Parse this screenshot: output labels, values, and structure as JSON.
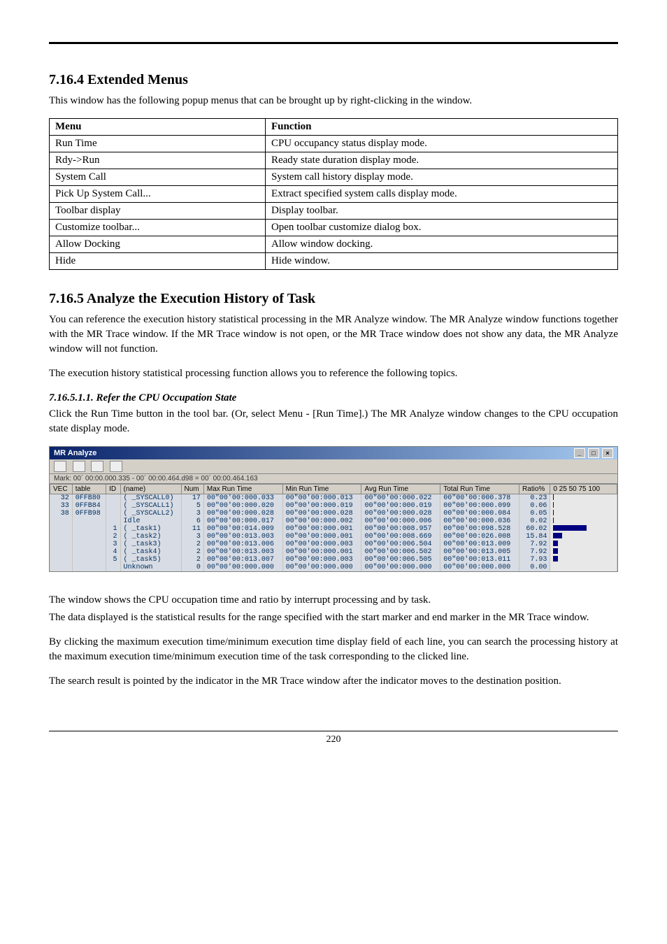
{
  "section1": {
    "heading": "7.16.4 Extended Menus",
    "intro": "This window has the following popup menus that can be brought up by right-clicking in the window.",
    "th_menu": "Menu",
    "th_func": "Function",
    "rows": [
      {
        "menu": "Run Time",
        "func": "CPU occupancy status display mode."
      },
      {
        "menu": "Rdy->Run",
        "func": "Ready state duration display mode."
      },
      {
        "menu": "System Call",
        "func": "System call history display mode."
      },
      {
        "menu": "Pick Up System Call...",
        "func": "Extract specified system calls display mode."
      },
      {
        "menu": "Toolbar display",
        "func": "Display toolbar."
      },
      {
        "menu": "Customize toolbar...",
        "func": "Open toolbar customize dialog box."
      },
      {
        "menu": "Allow Docking",
        "func": "Allow window docking."
      },
      {
        "menu": "Hide",
        "func": "Hide window."
      }
    ]
  },
  "section2": {
    "heading": "7.16.5 Analyze the Execution History of Task",
    "para1": "You can reference the execution history statistical processing in the MR Analyze window. The MR Analyze window functions together with the MR Trace window. If the MR Trace window is not open, or the MR Trace window does not show any data, the MR Analyze window will not function.",
    "para2": "The execution history statistical processing function allows you to reference the following topics.",
    "sub_heading": "7.16.5.1.1.    Refer the CPU Occupation State",
    "sub_para": "Click the Run Time button in the tool bar. (Or, select Menu - [Run Time].) The MR Analyze window changes to the CPU occupation state display mode."
  },
  "screenshot": {
    "title": "MR Analyze",
    "mark_text": "Mark: 00´ 00:00.000.335 - 00´ 00:00.464.d98 = 00´ 00:00.464.163",
    "headers": [
      "VEC",
      "table",
      "ID",
      "(name)",
      "Num",
      "Max Run Time",
      "Min Run Time",
      "Avg Run Time",
      "Total Run Time",
      "Ratio%"
    ],
    "scale": [
      "0",
      "25",
      "50",
      "75",
      "100"
    ],
    "rows": [
      {
        "vec": "32",
        "table": "0FFB80",
        "id": "",
        "name": "( _SYSCALL0)",
        "num": "17",
        "max": "00\"00'00:000.033",
        "min": "00\"00'00:000.013",
        "avg": "00\"00'00:000.022",
        "total": "00\"00'00:000.378",
        "ratio": "0.23",
        "bar": 0.5
      },
      {
        "vec": "33",
        "table": "0FFB84",
        "id": "",
        "name": "( _SYSCALL1)",
        "num": "5",
        "max": "00\"00'00:000.020",
        "min": "00\"00'00:000.019",
        "avg": "00\"00'00:000.019",
        "total": "00\"00'00:000.099",
        "ratio": "0.06",
        "bar": 0.2
      },
      {
        "vec": "38",
        "table": "0FFB98",
        "id": "",
        "name": "( _SYSCALL2)",
        "num": "3",
        "max": "00\"00'00:000.028",
        "min": "00\"00'00:000.028",
        "avg": "00\"00'00:000.028",
        "total": "00\"00'00:000.084",
        "ratio": "0.05",
        "bar": 0.2
      },
      {
        "vec": "",
        "table": "",
        "id": "",
        "name": "Idle",
        "num": "6",
        "max": "00\"00'00:000.017",
        "min": "00\"00'00:000.002",
        "avg": "00\"00'00:000.006",
        "total": "00\"00'00:000.036",
        "ratio": "0.02",
        "bar": 0.1
      },
      {
        "vec": "",
        "table": "",
        "id": "1",
        "name": "( _task1)",
        "num": "11",
        "max": "00\"00'00:014.009",
        "min": "00\"00'00:000.001",
        "avg": "00\"00'00:008.957",
        "total": "00\"00'00:098.528",
        "ratio": "60.02",
        "bar": 48
      },
      {
        "vec": "",
        "table": "",
        "id": "2",
        "name": "( _task2)",
        "num": "3",
        "max": "00\"00'00:013.003",
        "min": "00\"00'00:000.001",
        "avg": "00\"00'00:008.669",
        "total": "00\"00'00:026.008",
        "ratio": "15.84",
        "bar": 13
      },
      {
        "vec": "",
        "table": "",
        "id": "3",
        "name": "( _task3)",
        "num": "2",
        "max": "00\"00'00:013.006",
        "min": "00\"00'00:000.003",
        "avg": "00\"00'00:006.504",
        "total": "00\"00'00:013.009",
        "ratio": "7.92",
        "bar": 6.5
      },
      {
        "vec": "",
        "table": "",
        "id": "4",
        "name": "( _task4)",
        "num": "2",
        "max": "00\"00'00:013.003",
        "min": "00\"00'00:000.001",
        "avg": "00\"00'00:006.502",
        "total": "00\"00'00:013.005",
        "ratio": "7.92",
        "bar": 6.5
      },
      {
        "vec": "",
        "table": "",
        "id": "5",
        "name": "( _task5)",
        "num": "2",
        "max": "00\"00'00:013.007",
        "min": "00\"00'00:000.003",
        "avg": "00\"00'00:006.505",
        "total": "00\"00'00:013.011",
        "ratio": "7.93",
        "bar": 6.5
      },
      {
        "vec": "",
        "table": "",
        "id": "",
        "name": "Unknown",
        "num": "0",
        "max": "00\"00'00:000.000",
        "min": "00\"00'00:000.000",
        "avg": "00\"00'00:000.000",
        "total": "00\"00'00:000.000",
        "ratio": "0.00",
        "bar": 0
      }
    ]
  },
  "after": {
    "p1": "The window shows the CPU occupation time and ratio by interrupt processing and by task.",
    "p2": "The data displayed is the statistical results for the range specified with the start marker and end marker in the MR Trace window.",
    "p3": "By clicking the maximum execution time/minimum execution time display field of each line, you can search the processing history at the maximum execution time/minimum execution time of the task corresponding to the clicked line.",
    "p4": "The search result is pointed by the indicator in the MR Trace window after the indicator moves to the destination position."
  },
  "page_no": "220"
}
